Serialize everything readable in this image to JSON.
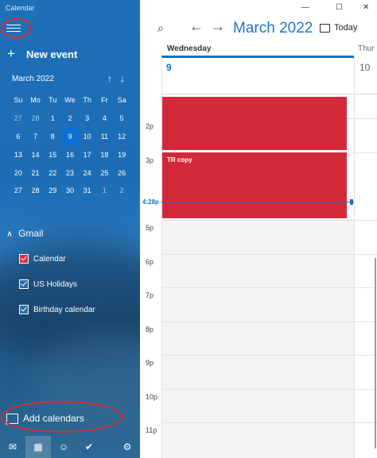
{
  "app": {
    "title": "Calendar"
  },
  "sidebar": {
    "new_event": "New event",
    "mini_calendar": {
      "month": "March 2022",
      "weekdays": [
        "Su",
        "Mo",
        "Tu",
        "We",
        "Th",
        "Fr",
        "Sa"
      ],
      "weeks": [
        [
          "27",
          "28",
          "1",
          "2",
          "3",
          "4",
          "5"
        ],
        [
          "6",
          "7",
          "8",
          "9",
          "10",
          "11",
          "12"
        ],
        [
          "13",
          "14",
          "15",
          "16",
          "17",
          "18",
          "19"
        ],
        [
          "20",
          "21",
          "22",
          "23",
          "24",
          "25",
          "26"
        ],
        [
          "27",
          "28",
          "29",
          "30",
          "31",
          "1",
          "2"
        ]
      ],
      "selected": "9"
    },
    "account": "Gmail",
    "calendars": [
      {
        "label": "Calendar",
        "color": "#d8303f"
      },
      {
        "label": "US Holidays",
        "color": "#2c6ea4"
      },
      {
        "label": "Birthday calendar",
        "color": "#2c6ea4"
      }
    ],
    "add_calendars": "Add calendars",
    "bottom_nav": [
      "mail-icon",
      "calendar-icon",
      "people-icon",
      "todo-icon",
      "settings-icon"
    ]
  },
  "header": {
    "month_title": "March 2022",
    "today_label": "Today"
  },
  "day_view": {
    "day_name": "Wednesday",
    "day_number": "9",
    "next_day_name": "Thur",
    "next_day_number": "10",
    "hours": [
      "2p",
      "3p",
      "5p",
      "6p",
      "7p",
      "8p",
      "9p",
      "10p",
      "11p"
    ],
    "now_label": "4:28p",
    "events": [
      {
        "title": ""
      },
      {
        "title": "TR copy"
      }
    ]
  },
  "colors": {
    "accent": "#1d6fc0",
    "event": "#d22a3a",
    "annotation": "#d82d2d"
  }
}
